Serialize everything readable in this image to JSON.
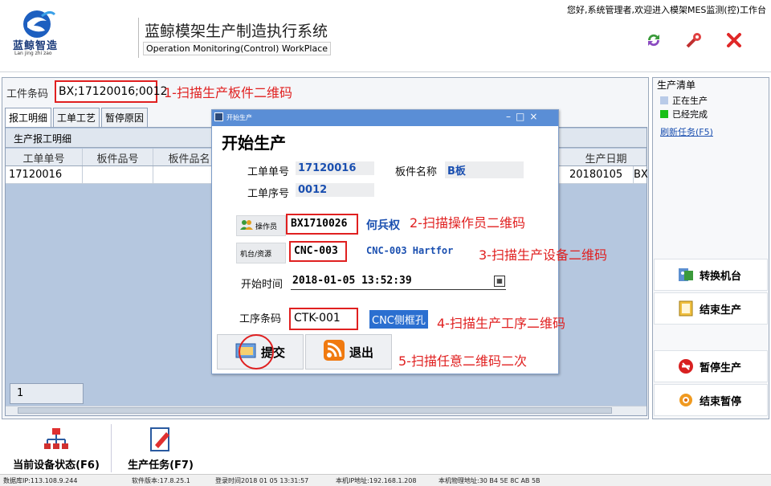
{
  "header": {
    "logo_text": "蓝鲸智造",
    "logo_sub": "Lan jing zhi zao",
    "title_cn": "蓝鲸模架生产制造执行系统",
    "title_en": "Operation Monitoring(Control) WorkPlace",
    "welcome": "您好,系统管理者,欢迎进入模架MES监测(控)工作台"
  },
  "barcode": {
    "label": "工件条码",
    "value": "BX;17120016;0012",
    "note": "1-扫描生产板件二维码"
  },
  "tabs": [
    "报工明细",
    "工单工艺",
    "暂停原因"
  ],
  "grid": {
    "title": "生产报工明细",
    "headers": [
      "工单单号",
      "板件品号",
      "板件品名",
      "生产日期"
    ],
    "row": {
      "order": "17120016",
      "part_no": "",
      "part_name": "",
      "date": "20180105",
      "trail": "BX"
    },
    "page": "1"
  },
  "right_panel": {
    "legend_title": "生产清单",
    "legend": [
      {
        "label": "正在生产",
        "color": "#b9cbe8"
      },
      {
        "label": "已经完成",
        "color": "#18c018"
      }
    ],
    "refresh": "刷新任务(F5)",
    "buttons": [
      {
        "label": "转换机台",
        "icon": "switch-icon"
      },
      {
        "label": "结束生产",
        "icon": "finish-icon"
      },
      {
        "label": "暂停生产",
        "icon": "pause-icon"
      },
      {
        "label": "结束暂停",
        "icon": "resume-icon"
      }
    ]
  },
  "bottom": {
    "btn1": "当前设备状态(F6)",
    "btn2": "生产任务(F7)"
  },
  "status": {
    "server": "数据库IP:113.108.9.244",
    "version": "软件版本:17.8.25.1",
    "login_time": "登录时间2018 01 05 13:31:57",
    "local_ip": "本机IP地址:192.168.1.208",
    "mac": "本机物理地址:30 B4 5E 8C AB 5B"
  },
  "dialog": {
    "titlebar": "开始生产",
    "heading": "开始生产",
    "order_label": "工单单号",
    "order_value": "17120016",
    "part_label": "板件名称",
    "part_value": "B板",
    "seq_label": "工单序号",
    "seq_value": "0012",
    "operator_label": "操作员",
    "operator_code": "BX1710026",
    "operator_name": "何兵权",
    "operator_note": "2-扫描操作员二维码",
    "machine_label": "机台/资源",
    "machine_code": "CNC-003",
    "machine_name": "CNC-003 Hartfor",
    "machine_note": "3-扫描生产设备二维码",
    "start_label": "开始时间",
    "start_value": "2018-01-05 13:52:39",
    "process_label": "工序条码",
    "process_code": "CTK-001",
    "process_name": "CNC侧框孔",
    "process_note": "4-扫描生产工序二维码",
    "submit": "提交",
    "exit": "退出",
    "submit_note": "5-扫描任意二维码二次"
  }
}
